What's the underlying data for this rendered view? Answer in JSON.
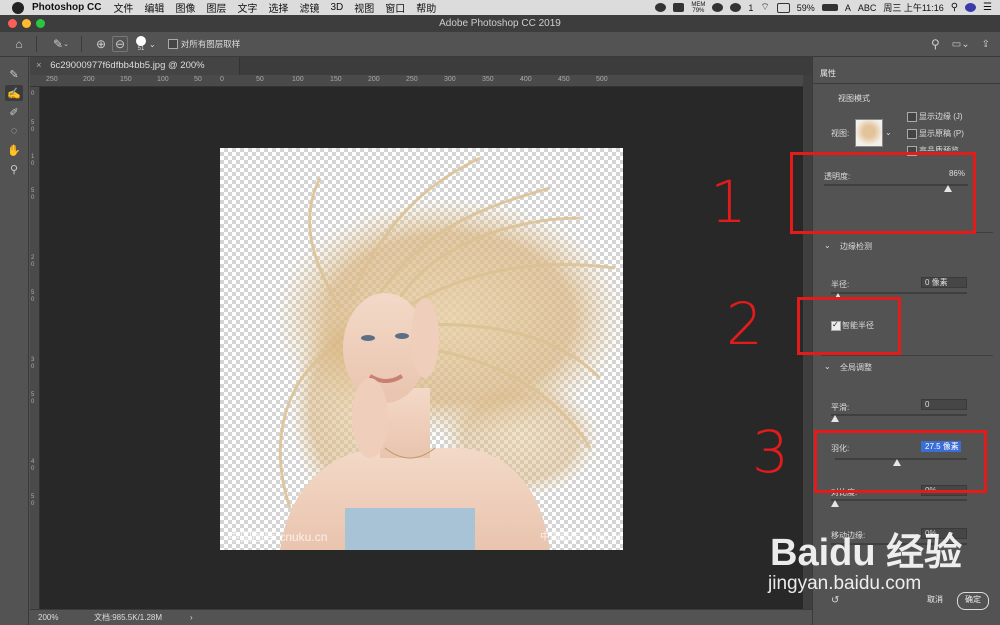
{
  "menubar": {
    "app": "Photoshop CC",
    "items": [
      "文件",
      "编辑",
      "图像",
      "图层",
      "文字",
      "选择",
      "滤镜",
      "3D",
      "视图",
      "窗口",
      "帮助"
    ],
    "mem_label": "MEM",
    "mem_value": "79%",
    "badge": "1",
    "battery": "59%",
    "input_method": "ABC",
    "clock": "周三 上午11:16"
  },
  "window": {
    "title": "Adobe Photoshop CC 2019"
  },
  "options": {
    "brush_size": "51",
    "sample_all_layers": "对所有图层取样"
  },
  "document": {
    "tab_title": "6c29000977f6dfbb4bb5.jpg @ 200%(RGB/8) *",
    "watermark_left": "中国图库 cnuku.cn",
    "watermark_right": "中国图库 cnuku.cn"
  },
  "rulers": {
    "h": [
      "250",
      "200",
      "150",
      "100",
      "50",
      "0",
      "50",
      "100",
      "150",
      "200",
      "250",
      "300",
      "350",
      "400",
      "450",
      "500"
    ],
    "v": [
      "0",
      "5",
      "0",
      "1",
      "0",
      "5",
      "0",
      "2",
      "0",
      "5",
      "0",
      "3",
      "0",
      "5",
      "0",
      "4",
      "0",
      "5",
      "0"
    ]
  },
  "status": {
    "zoom": "200%",
    "doc": "文档:985.5K/1.28M",
    "arrow": "›"
  },
  "properties": {
    "tab": "属性",
    "view_mode": {
      "title": "视图模式",
      "view_label": "视图:",
      "show_edge": "显示边缘 (J)",
      "show_original": "显示原稿 (P)",
      "high_quality": "高品质预览"
    },
    "opacity": {
      "label": "透明度:",
      "value": "86%",
      "level": 86
    },
    "edge_detection": {
      "title": "边缘检测",
      "radius_label": "半径:",
      "radius_value": "0 像素",
      "smart_radius": "智能半径"
    },
    "global": {
      "title": "全局调整",
      "smooth_label": "平滑:",
      "smooth_value": "0",
      "feather_label": "羽化:",
      "feather_value": "27.5 像素",
      "contrast_label": "对比度:",
      "contrast_value": "0%",
      "shift_label": "移动边缘:",
      "shift_value": "0%"
    },
    "cancel": "取消",
    "ok": "确定"
  },
  "annotations": [
    "1",
    "2",
    "3"
  ],
  "baidu": {
    "brand": "Baidu 经验",
    "url": "jingyan.baidu.com"
  },
  "colors": {
    "annotation_red": "#e41b1b",
    "selected_field": "#3b6dd6",
    "canvas": "#282828",
    "panel": "#535353"
  }
}
